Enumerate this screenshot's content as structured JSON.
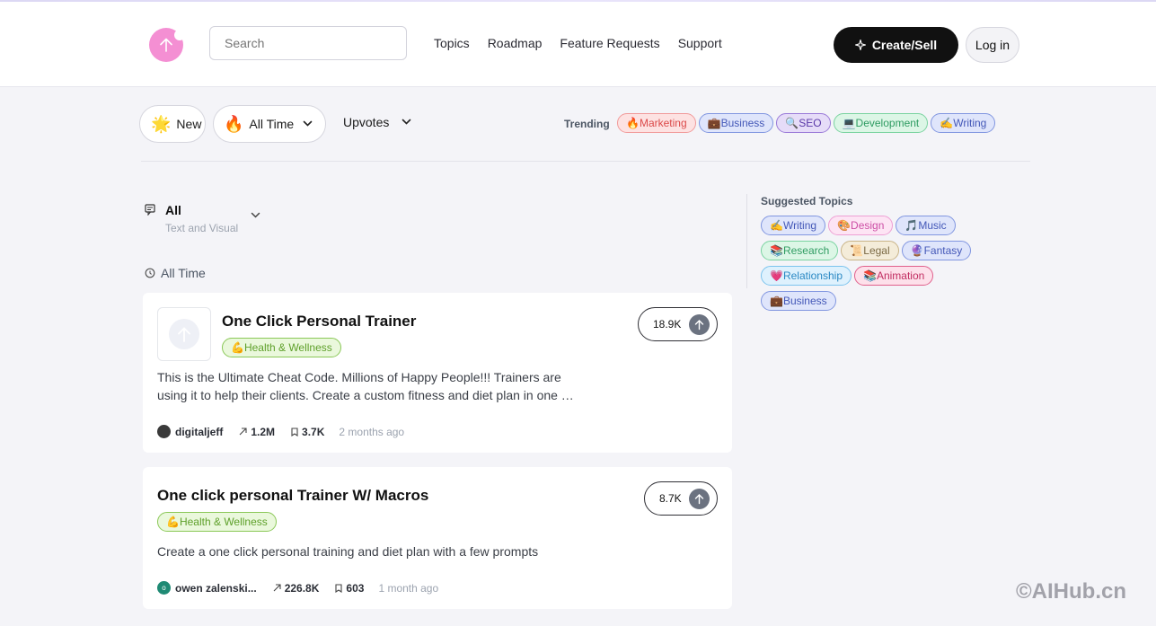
{
  "header": {
    "search_placeholder": "Search",
    "nav": [
      "Topics",
      "Roadmap",
      "Feature Requests",
      "Support"
    ],
    "create_label": "Create/Sell",
    "login_label": "Log in"
  },
  "filters": {
    "new_label": "New",
    "new_emoji": "🌟",
    "time_label": "All Time",
    "time_emoji": "🔥",
    "sort_label": "Upvotes",
    "trending_label": "Trending",
    "trending": [
      {
        "emoji": "🔥",
        "label": "Marketing",
        "color": "red"
      },
      {
        "emoji": "💼",
        "label": "Business",
        "color": "blue"
      },
      {
        "emoji": "🔍",
        "label": "SEO",
        "color": "purple"
      },
      {
        "emoji": "💻",
        "label": "Development",
        "color": "green"
      },
      {
        "emoji": "✍️",
        "label": "Writing",
        "color": "blue"
      }
    ]
  },
  "content_filter": {
    "title": "All",
    "subtitle": "Text and Visual",
    "period_label": "All Time"
  },
  "cards": [
    {
      "title": "One Click Personal Trainer",
      "tag_emoji": "💪",
      "tag": "Health & Wellness",
      "description": "This is the Ultimate Cheat Code. Millions of Happy People!!! Trainers are using it to help their clients. Create a custom fitness and diet plan in one …",
      "author": "digitaljeff",
      "views": "1.2M",
      "saves": "3.7K",
      "time": "2 months ago",
      "votes": "18.9K",
      "has_thumb": true
    },
    {
      "title": "One click personal Trainer W/ Macros",
      "tag_emoji": "💪",
      "tag": "Health & Wellness",
      "description": "Create a one click personal training and diet plan with a few prompts",
      "author": "owen zalenski...",
      "avatar_letter": "o",
      "views": "226.8K",
      "saves": "603",
      "time": "1 month ago",
      "votes": "8.7K",
      "has_thumb": false
    }
  ],
  "suggested": {
    "title": "Suggested Topics",
    "rows": [
      [
        {
          "emoji": "✍️",
          "label": "Writing",
          "color": "blue"
        },
        {
          "emoji": "🎨",
          "label": "Design",
          "color": "pink"
        },
        {
          "emoji": "🎵",
          "label": "Music",
          "color": "blue"
        }
      ],
      [
        {
          "emoji": "📚",
          "label": "Research",
          "color": "green"
        },
        {
          "emoji": "📜",
          "label": "Legal",
          "color": "tan"
        },
        {
          "emoji": "🔮",
          "label": "Fantasy",
          "color": "blue"
        }
      ],
      [
        {
          "emoji": "💗",
          "label": "Relationship",
          "color": "sky"
        },
        {
          "emoji": "📚",
          "label": "Animation",
          "color": "rose"
        }
      ],
      [
        {
          "emoji": "💼",
          "label": "Business",
          "color": "blue"
        }
      ]
    ]
  },
  "watermark": "©AIHub.cn"
}
